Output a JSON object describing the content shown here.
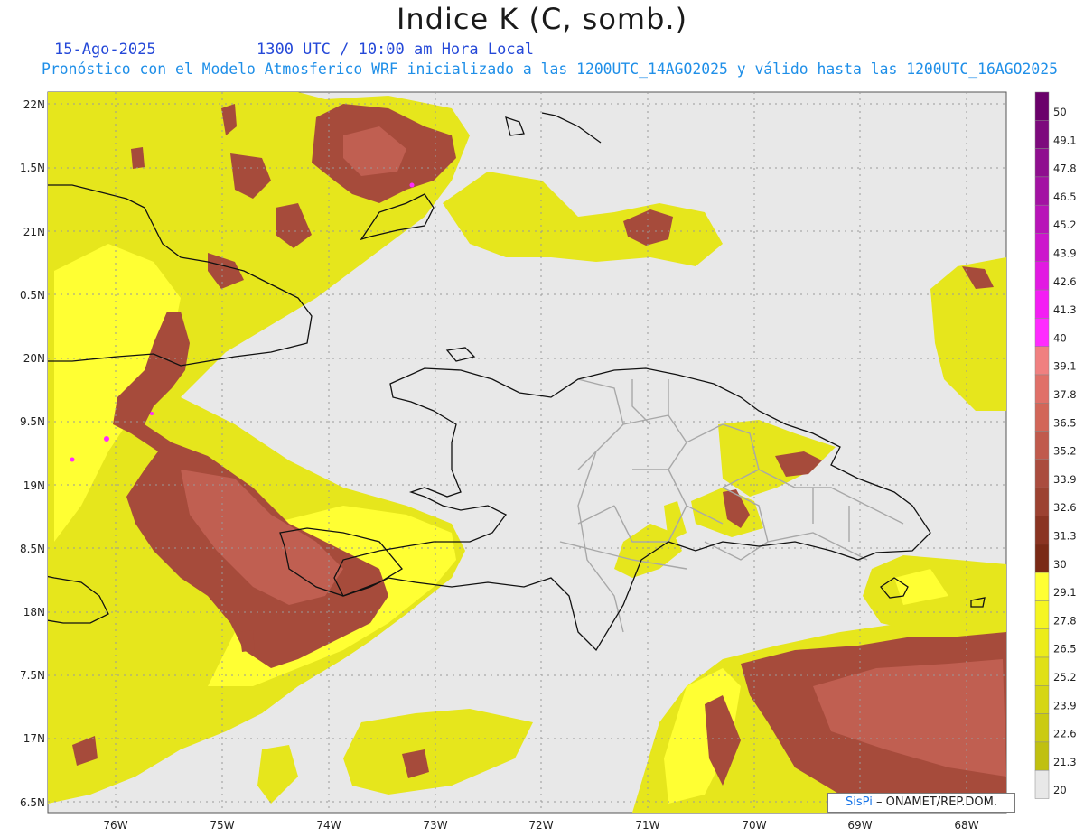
{
  "title": "Indice K (C, somb.)",
  "date": "15-Ago-2025",
  "time": "1300 UTC / 10:00 am Hora Local",
  "description": "Pronóstico con el Modelo Atmosferico WRF inicializado a las 1200UTC_14AGO2025 y válido hasta las  1200UTC_16AGO2025",
  "credit": {
    "brand": "SisPi",
    "text": "– ONAMET/REP.DOM."
  },
  "map": {
    "lat_labels": [
      "22N",
      "1.5N",
      "21N",
      "0.5N",
      "20N",
      "9.5N",
      "19N",
      "8.5N",
      "18N",
      "7.5N",
      "17N",
      "6.5N"
    ],
    "lon_labels": [
      "76W",
      "75W",
      "74W",
      "73W",
      "72W",
      "71W",
      "70W",
      "69W",
      "68W"
    ],
    "background": "#e8e8e8"
  },
  "colorbar": {
    "levels": [
      "50",
      "49.1",
      "47.8",
      "46.5",
      "45.2",
      "43.9",
      "42.6",
      "41.3",
      "40",
      "39.1",
      "37.8",
      "36.5",
      "35.2",
      "33.9",
      "32.6",
      "31.3",
      "30",
      "29.1",
      "27.8",
      "26.5",
      "25.2",
      "23.9",
      "22.6",
      "21.3",
      "20"
    ],
    "colors": [
      "#6b006b",
      "#7d0a7d",
      "#8f0f8f",
      "#a312a3",
      "#b814b8",
      "#cc16cc",
      "#e21ae2",
      "#f41ef4",
      "#ff2bff",
      "#f08080",
      "#e07068",
      "#d26658",
      "#c05a4c",
      "#aa4c3e",
      "#9c4231",
      "#8a3422",
      "#7a2a16",
      "#ffff33",
      "#f5f522",
      "#ecec1a",
      "#e0e016",
      "#d6d614",
      "#cbcb12",
      "#c0c010",
      "#e8e8e8"
    ]
  }
}
